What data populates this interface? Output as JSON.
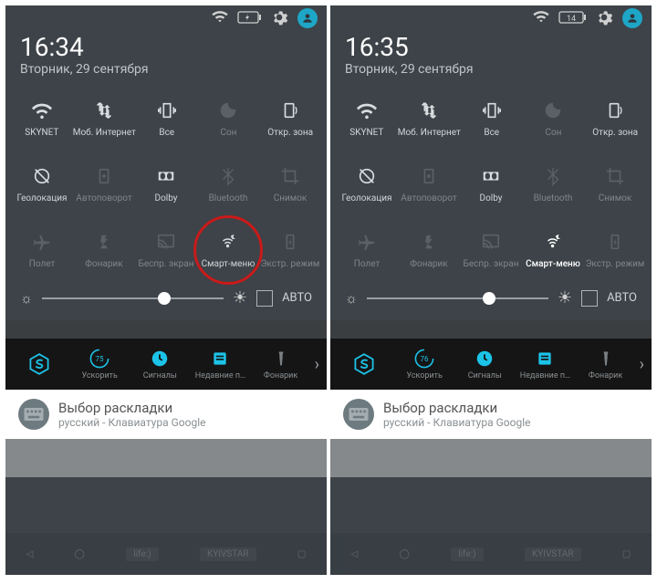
{
  "phones": [
    {
      "time": "16:34",
      "date": "Вторник, 29 сентября",
      "battery_label": "",
      "smart_menu_active": false,
      "circle": true,
      "tools_speed": "75"
    },
    {
      "time": "16:35",
      "date": "Вторник, 29 сентября",
      "battery_label": "14",
      "smart_menu_active": true,
      "circle": false,
      "tools_speed": "76"
    }
  ],
  "tiles": {
    "row0": [
      "SKYNET",
      "Моб. Интернет",
      "Все",
      "Сон",
      "Откр. зона"
    ],
    "row1": [
      "Геолокация",
      "Автоповорот",
      "Dolby",
      "Bluetooth",
      "Снимок"
    ],
    "row2": [
      "Полет",
      "Фонарик",
      "Беспр. экран",
      "Смарт-меню",
      "Экстр. режим"
    ]
  },
  "auto_label": "АВТО",
  "tools": [
    "Ускорить",
    "Сигналы",
    "Недавние п…",
    "Фонарик"
  ],
  "notif": {
    "title": "Выбор раскладки",
    "sub": "русский - Клавиатура Google"
  },
  "nav": {
    "a": "life:)",
    "b": "KYIVSTAR"
  }
}
